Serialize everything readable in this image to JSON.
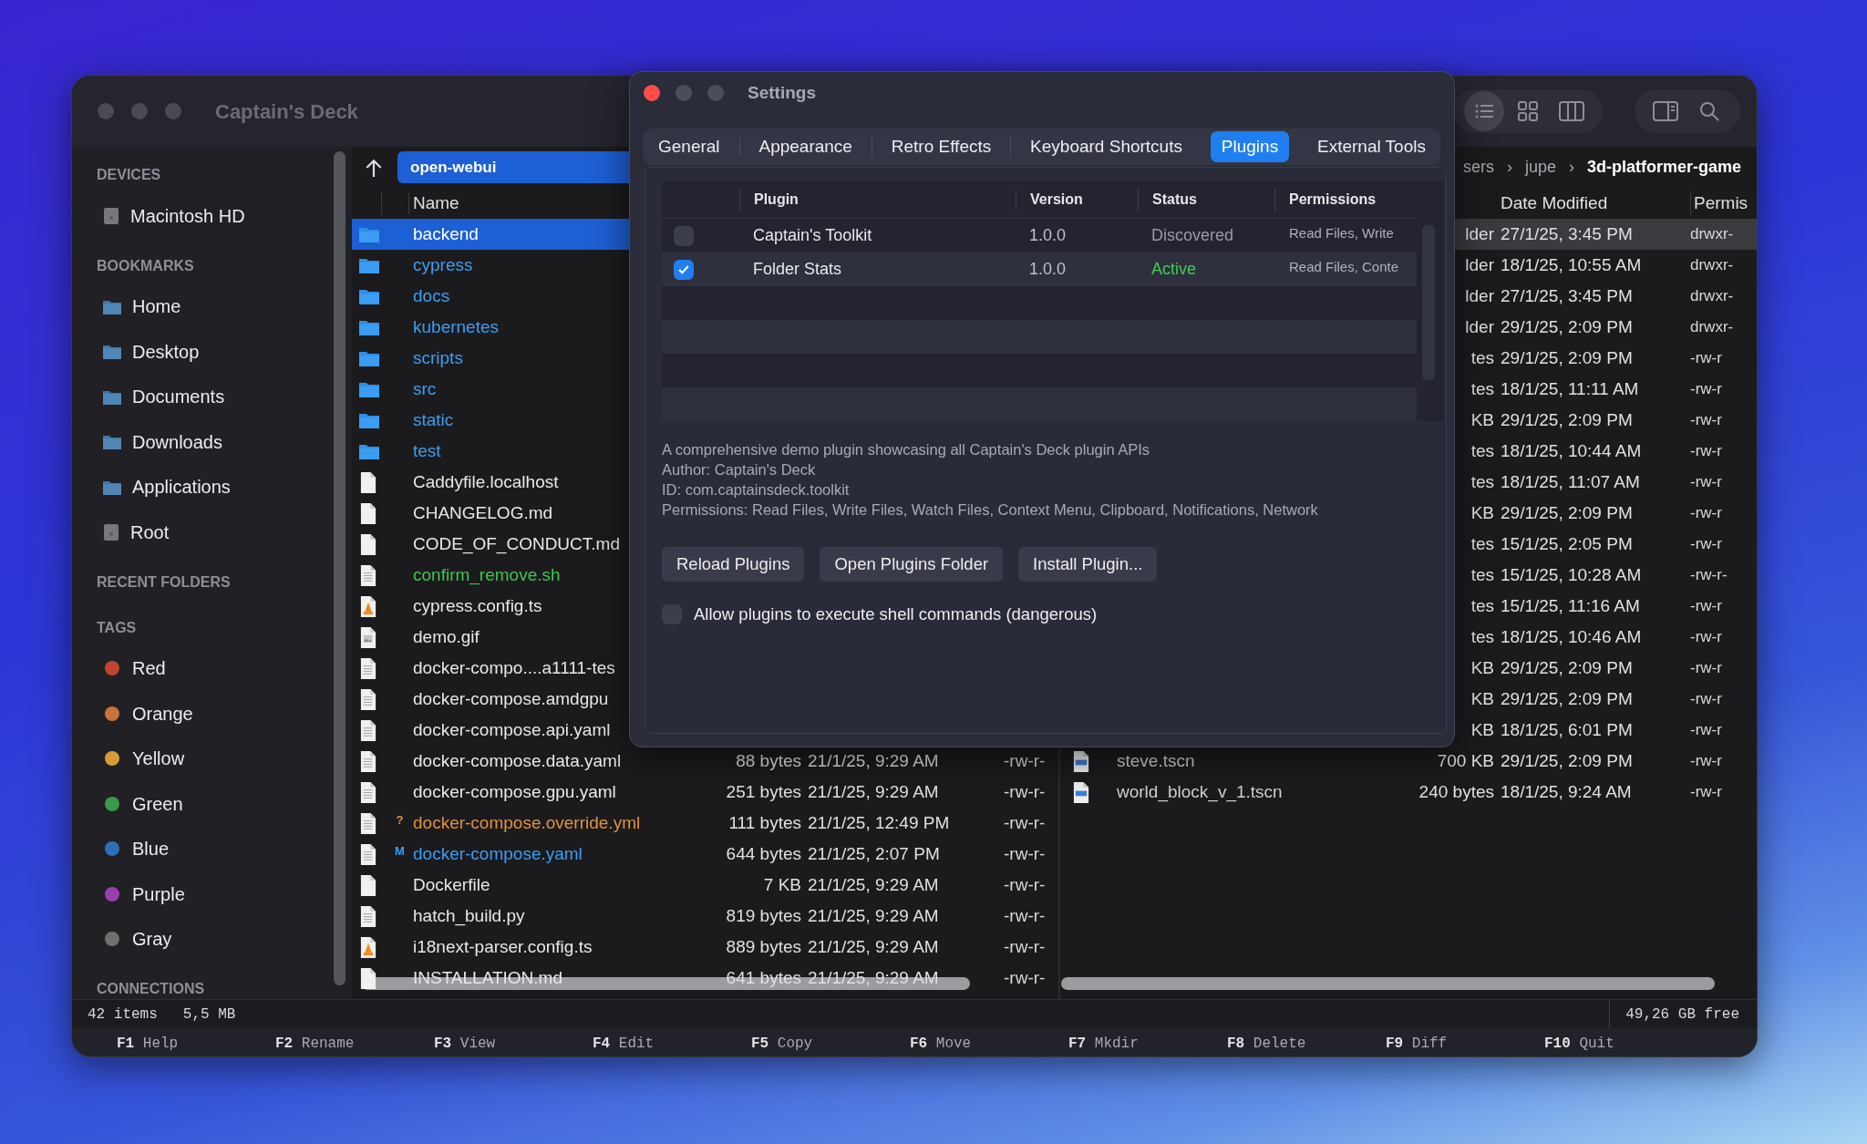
{
  "main_window": {
    "title": "Captain's Deck"
  },
  "view_modes": [
    {
      "kind": "list",
      "selected": true
    },
    {
      "kind": "grid",
      "selected": false
    },
    {
      "kind": "columns",
      "selected": false
    }
  ],
  "tools": [
    {
      "kind": "panel"
    },
    {
      "kind": "search"
    }
  ],
  "sidebar": {
    "sections": [
      {
        "title": "DEVICES",
        "items": [
          {
            "kind": "disk",
            "label": "Macintosh HD"
          }
        ]
      },
      {
        "title": "BOOKMARKS",
        "items": [
          {
            "kind": "folder",
            "label": "Home"
          },
          {
            "kind": "folder",
            "label": "Desktop"
          },
          {
            "kind": "folder",
            "label": "Documents"
          },
          {
            "kind": "folder",
            "label": "Downloads"
          },
          {
            "kind": "folder",
            "label": "Applications"
          },
          {
            "kind": "disk",
            "label": "Root"
          }
        ]
      },
      {
        "title": "RECENT FOLDERS"
      },
      {
        "title": "TAGS",
        "items": [
          {
            "kind": "tag",
            "label": "Red",
            "color": "#c2452f"
          },
          {
            "kind": "tag",
            "label": "Orange",
            "color": "#c8743a"
          },
          {
            "kind": "tag",
            "label": "Yellow",
            "color": "#d89a38"
          },
          {
            "kind": "tag",
            "label": "Green",
            "color": "#3b9a47"
          },
          {
            "kind": "tag",
            "label": "Blue",
            "color": "#2f6fb8"
          },
          {
            "kind": "tag",
            "label": "Purple",
            "color": "#9a3fb0"
          },
          {
            "kind": "tag",
            "label": "Gray",
            "color": "#707070"
          }
        ]
      },
      {
        "title": "CONNECTIONS"
      }
    ]
  },
  "left_pane": {
    "path": "open-webui",
    "columns": [
      "Name"
    ],
    "rows": [
      {
        "kind": "folder",
        "name": "backend",
        "color": "#ffffff",
        "selected": true
      },
      {
        "kind": "folder",
        "name": "cypress",
        "color": "#3d9df5",
        "selected": false
      },
      {
        "kind": "folder",
        "name": "docs",
        "color": "#3d9df5",
        "selected": false
      },
      {
        "kind": "folder",
        "name": "kubernetes",
        "color": "#3d9df5",
        "selected": false
      },
      {
        "kind": "folder",
        "name": "scripts",
        "color": "#3d9df5",
        "selected": false
      },
      {
        "kind": "folder",
        "name": "src",
        "color": "#3d9df5",
        "selected": false
      },
      {
        "kind": "folder",
        "name": "static",
        "color": "#3d9df5",
        "selected": false
      },
      {
        "kind": "folder",
        "name": "test",
        "color": "#3d9df5",
        "selected": false
      },
      {
        "kind": "blank",
        "name": "Caddyfile.localhost",
        "color": "#e8e8ea",
        "selected": false
      },
      {
        "kind": "blank",
        "name": "CHANGELOG.md",
        "color": "#e8e8ea",
        "selected": false
      },
      {
        "kind": "blank",
        "name": "CODE_OF_CONDUCT.md",
        "color": "#e8e8ea",
        "selected": false
      },
      {
        "kind": "lines",
        "name": "confirm_remove.sh",
        "color": "#3ec64e",
        "selected": false
      },
      {
        "kind": "cone",
        "name": "cypress.config.ts",
        "color": "#e8e8ea",
        "selected": false
      },
      {
        "kind": "image",
        "name": "demo.gif",
        "color": "#e8e8ea",
        "selected": false
      },
      {
        "kind": "lines",
        "name": "docker-compo....a1111-tes",
        "color": "#e8e8ea",
        "selected": false
      },
      {
        "kind": "lines",
        "name": "docker-compose.amdgpu",
        "color": "#e8e8ea",
        "selected": false
      },
      {
        "kind": "lines",
        "name": "docker-compose.api.yaml",
        "color": "#e8e8ea",
        "selected": false
      },
      {
        "kind": "lines",
        "name": "docker-compose.data.yaml",
        "color": "#e8e8ea",
        "selected": false,
        "size": "88 bytes",
        "date": "21/1/25, 9:29 AM",
        "perms": "-rw-r-"
      },
      {
        "kind": "lines",
        "name": "docker-compose.gpu.yaml",
        "color": "#e8e8ea",
        "selected": false,
        "size": "251 bytes",
        "date": "21/1/25, 9:29 AM",
        "perms": "-rw-r-"
      },
      {
        "kind": "lines",
        "marker": "?",
        "name": "docker-compose.override.yml",
        "color": "#e2913f",
        "selected": false,
        "size": "111 bytes",
        "date": "21/1/25, 12:49 PM",
        "perms": "-rw-r-"
      },
      {
        "kind": "lines",
        "marker": "M",
        "name": "docker-compose.yaml",
        "color": "#3d9df5",
        "selected": false,
        "size": "644 bytes",
        "date": "21/1/25, 2:07 PM",
        "perms": "-rw-r-"
      },
      {
        "kind": "blank",
        "name": "Dockerfile",
        "color": "#e8e8ea",
        "selected": false,
        "size": "7 KB",
        "date": "21/1/25, 9:29 AM",
        "perms": "-rw-r-"
      },
      {
        "kind": "lines",
        "name": "hatch_build.py",
        "color": "#e8e8ea",
        "selected": false,
        "size": "819 bytes",
        "date": "21/1/25, 9:29 AM",
        "perms": "-rw-r-"
      },
      {
        "kind": "cone",
        "name": "i18next-parser.config.ts",
        "color": "#e8e8ea",
        "selected": false,
        "size": "889 bytes",
        "date": "21/1/25, 9:29 AM",
        "perms": "-rw-r-"
      },
      {
        "kind": "blank",
        "name": "INSTALLATION.md",
        "color": "#e8e8ea",
        "selected": false,
        "size": "641 bytes",
        "date": "21/1/25, 9:29 AM",
        "perms": "-rw-r-"
      }
    ]
  },
  "right_pane": {
    "breadcrumb": [
      {
        "kind": "crumb",
        "label": "sers",
        "current": false
      },
      {
        "kind": "sep",
        "label": "›"
      },
      {
        "kind": "crumb",
        "label": "jupe",
        "current": false
      },
      {
        "kind": "sep",
        "label": "›"
      },
      {
        "kind": "crumb",
        "label": "3d-platformer-game",
        "current": true
      }
    ],
    "columns": [
      "Date Modified",
      "Permis"
    ],
    "rows": [
      {
        "size": "lder",
        "date": "27/1/25, 3:45 PM",
        "perms": "drwxr-",
        "selected": true
      },
      {
        "size": "lder",
        "date": "18/1/25, 10:55 AM",
        "perms": "drwxr-",
        "selected": false
      },
      {
        "size": "lder",
        "date": "27/1/25, 3:45 PM",
        "perms": "drwxr-",
        "selected": false
      },
      {
        "size": "lder",
        "date": "29/1/25, 2:09 PM",
        "perms": "drwxr-",
        "selected": false
      },
      {
        "size": "tes",
        "date": "29/1/25, 2:09 PM",
        "perms": "-rw-r",
        "selected": false
      },
      {
        "size": "tes",
        "date": "18/1/25, 11:11 AM",
        "perms": "-rw-r",
        "selected": false
      },
      {
        "size": "KB",
        "date": "29/1/25, 2:09 PM",
        "perms": "-rw-r",
        "selected": false
      },
      {
        "size": "tes",
        "date": "18/1/25, 10:44 AM",
        "perms": "-rw-r",
        "selected": false
      },
      {
        "size": "tes",
        "date": "18/1/25, 11:07 AM",
        "perms": "-rw-r",
        "selected": false
      },
      {
        "size": "KB",
        "date": "29/1/25, 2:09 PM",
        "perms": "-rw-r",
        "selected": false
      },
      {
        "size": "tes",
        "date": "15/1/25, 2:05 PM",
        "perms": "-rw-r",
        "selected": false
      },
      {
        "size": "tes",
        "date": "15/1/25, 10:28 AM",
        "perms": "-rw-r-",
        "selected": false
      },
      {
        "size": "tes",
        "date": "15/1/25, 11:16 AM",
        "perms": "-rw-r",
        "selected": false
      },
      {
        "size": "tes",
        "date": "18/1/25, 10:46 AM",
        "perms": "-rw-r",
        "selected": false
      },
      {
        "size": "KB",
        "date": "29/1/25, 2:09 PM",
        "perms": "-rw-r",
        "selected": false
      },
      {
        "size": "KB",
        "date": "29/1/25, 2:09 PM",
        "perms": "-rw-r",
        "selected": false
      },
      {
        "size": "KB",
        "date": "18/1/25, 6:01 PM",
        "perms": "-rw-r",
        "selected": false
      },
      {
        "kind": "scene",
        "name": "steve.tscn",
        "size": "700 KB",
        "date": "29/1/25, 2:09 PM",
        "perms": "-rw-r",
        "selected": false
      },
      {
        "kind": "scene",
        "name": "world_block_v_1.tscn",
        "size": "240 bytes",
        "date": "18/1/25, 9:24 AM",
        "perms": "-rw-r",
        "selected": false
      }
    ]
  },
  "status_bar": {
    "count": "42 items",
    "size": "5,5 MB",
    "free": "49,26 GB free"
  },
  "function_keys": [
    {
      "key": "F1",
      "label": "Help"
    },
    {
      "key": "F2",
      "label": "Rename"
    },
    {
      "key": "F3",
      "label": "View"
    },
    {
      "key": "F4",
      "label": "Edit"
    },
    {
      "key": "F5",
      "label": "Copy"
    },
    {
      "key": "F6",
      "label": "Move"
    },
    {
      "key": "F7",
      "label": "Mkdir"
    },
    {
      "key": "F8",
      "label": "Delete"
    },
    {
      "key": "F9",
      "label": "Diff"
    },
    {
      "key": "F10",
      "label": "Quit"
    }
  ],
  "settings": {
    "title": "Settings",
    "tabs": [
      {
        "label": "General",
        "selected": false
      },
      {
        "label": "Appearance",
        "selected": false
      },
      {
        "label": "Retro Effects",
        "selected": false
      },
      {
        "label": "Keyboard Shortcuts",
        "selected": false
      },
      {
        "label": "Plugins",
        "selected": true
      },
      {
        "label": "External Tools",
        "selected": false
      }
    ],
    "table": {
      "columns": [
        "Plugin",
        "Version",
        "Status",
        "Permissions"
      ],
      "rows": [
        {
          "enabled": false,
          "name": "Captain's Toolkit",
          "version": "1.0.0",
          "status": {
            "text": "Discovered",
            "color": "#9a9aa3"
          },
          "permissions": "Read Files, Write"
        },
        {
          "enabled": true,
          "name": "Folder Stats",
          "version": "1.0.0",
          "status": {
            "text": "Active",
            "color": "#3ecf4f"
          },
          "permissions": "Read Files, Conte"
        }
      ]
    },
    "description": [
      "A comprehensive demo plugin showcasing all Captain's Deck plugin APIs",
      "Author: Captain's Deck",
      "ID: com.captainsdeck.toolkit",
      "Permissions: Read Files, Write Files, Watch Files, Context Menu, Clipboard, Notifications, Network"
    ],
    "buttons": [
      "Reload Plugins",
      "Open Plugins Folder",
      "Install Plugin..."
    ],
    "option": {
      "label": "Allow plugins to execute shell commands (dangerous)",
      "checked": false
    }
  }
}
